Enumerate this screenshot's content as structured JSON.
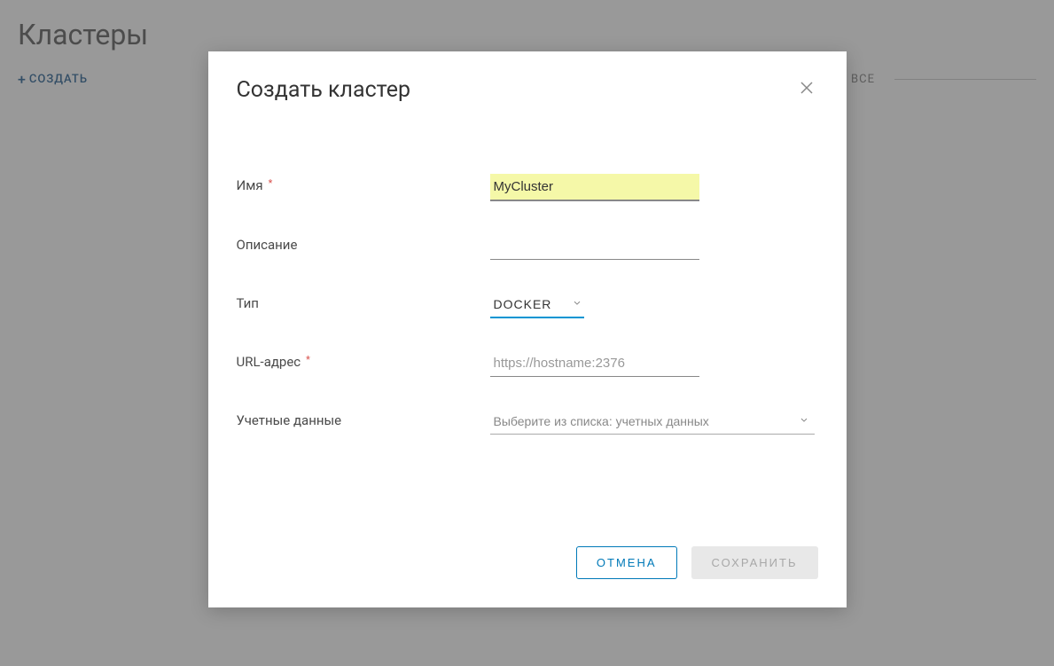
{
  "page": {
    "title": "Кластеры",
    "create_label": "СОЗДАТЬ",
    "all_label": "ВСЕ"
  },
  "modal": {
    "title": "Создать кластер",
    "fields": {
      "name": {
        "label": "Имя",
        "value": "MyCluster"
      },
      "description": {
        "label": "Описание",
        "value": ""
      },
      "type": {
        "label": "Тип",
        "value": "DOCKER"
      },
      "url": {
        "label": "URL-адрес",
        "placeholder": "https://hostname:2376",
        "value": ""
      },
      "credentials": {
        "label": "Учетные данные",
        "placeholder": "Выберите из списка: учетных данных"
      }
    },
    "buttons": {
      "cancel": "ОТМЕНА",
      "save": "СОХРАНИТЬ"
    }
  }
}
